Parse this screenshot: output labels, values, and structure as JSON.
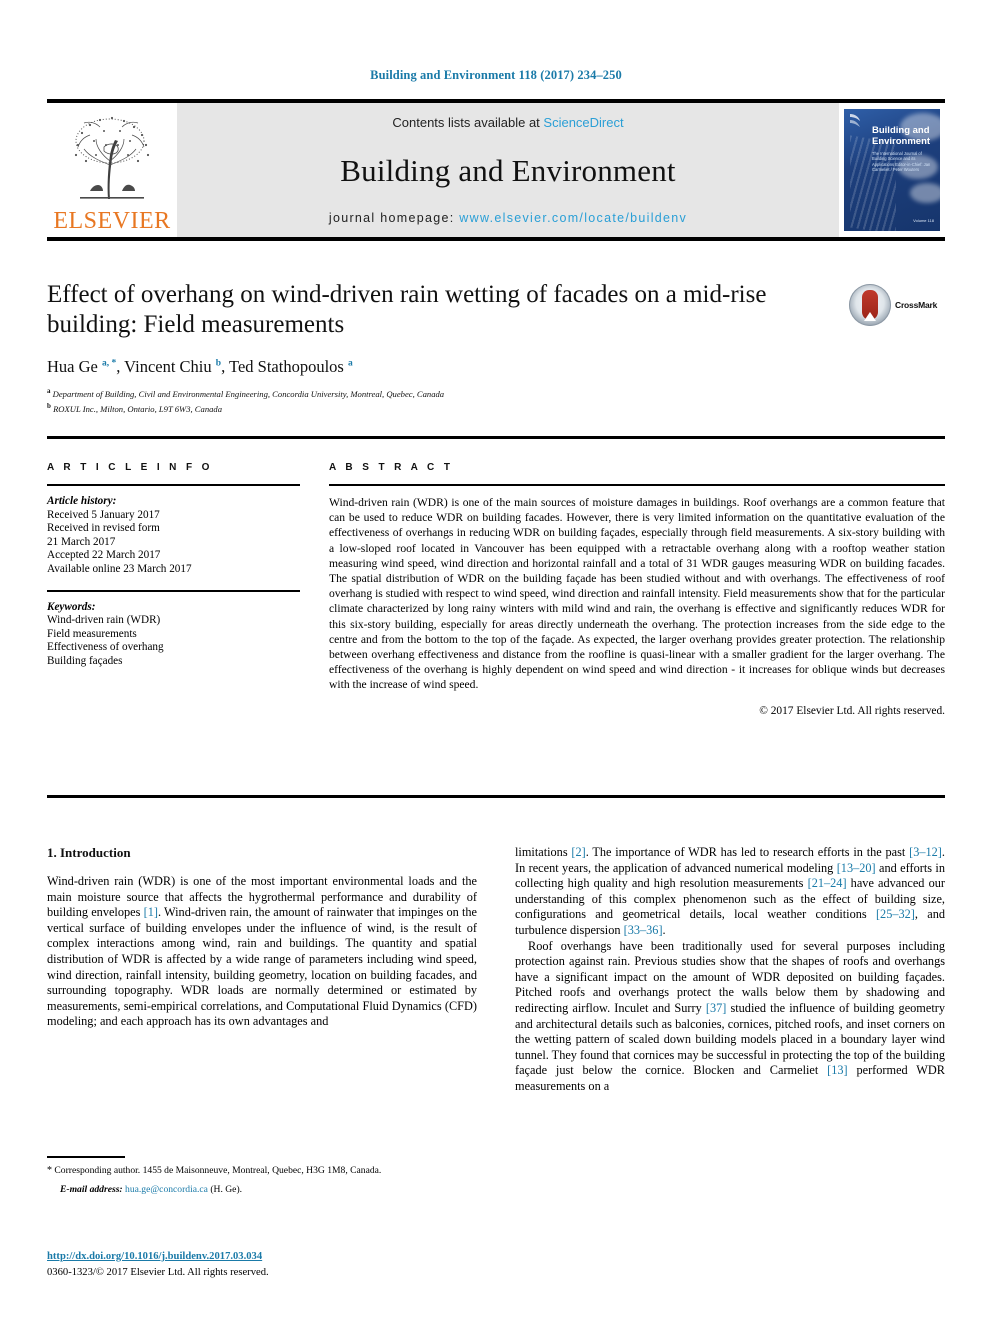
{
  "running_head": "Building and Environment 118 (2017) 234–250",
  "masthead": {
    "publisher_name": "ELSEVIER",
    "contents_prefix": "Contents lists available at ",
    "contents_link": "ScienceDirect",
    "journal_name": "Building and Environment",
    "homepage_prefix": "journal homepage: ",
    "homepage_url": "www.elsevier.com/locate/buildenv",
    "cover": {
      "title_line1": "Building and",
      "title_line2": "Environment",
      "subtitle": "The International Journal of Building Science and its Applications Editor-in-Chief: Jan Carmeliet / Peter Wouters",
      "bottom_note": "Volume 118"
    }
  },
  "crossmark": {
    "label": "CrossMark"
  },
  "article": {
    "title": "Effect of overhang on wind-driven rain wetting of facades on a mid-rise building: Field measurements",
    "authors_html": "Hua Ge <sup>a, *</sup>, Vincent Chiu <sup>b</sup>, Ted Stathopoulos <sup>a</sup>",
    "affiliations": [
      {
        "marker": "a",
        "text": "Department of Building, Civil and Environmental Engineering, Concordia University, Montreal, Quebec, Canada"
      },
      {
        "marker": "b",
        "text": "ROXUL Inc., Milton, Ontario, L9T 6W3, Canada"
      }
    ]
  },
  "article_info": {
    "heading": "A R T I C L E  I N F O",
    "history_label": "Article history:",
    "history": [
      "Received 5 January 2017",
      "Received in revised form",
      "21 March 2017",
      "Accepted 22 March 2017",
      "Available online 23 March 2017"
    ],
    "keywords_label": "Keywords:",
    "keywords": [
      "Wind-driven rain (WDR)",
      "Field measurements",
      "Effectiveness of overhang",
      "Building façades"
    ]
  },
  "abstract": {
    "heading": "A B S T R A C T",
    "text": "Wind-driven rain (WDR) is one of the main sources of moisture damages in buildings. Roof overhangs are a common feature that can be used to reduce WDR on building facades. However, there is very limited information on the quantitative evaluation of the effectiveness of overhangs in reducing WDR on building façades, especially through field measurements. A six-story building with a low-sloped roof located in Vancouver has been equipped with a retractable overhang along with a rooftop weather station measuring wind speed, wind direction and horizontal rainfall and a total of 31 WDR gauges measuring WDR on building facades. The spatial distribution of WDR on the building façade has been studied without and with overhangs. The effectiveness of roof overhang is studied with respect to wind speed, wind direction and rainfall intensity. Field measurements show that for the particular climate characterized by long rainy winters with mild wind and rain, the overhang is effective and significantly reduces WDR for this six-story building, especially for areas directly underneath the overhang. The protection increases from the side edge to the centre and from the bottom to the top of the façade. As expected, the larger overhang provides greater protection. The relationship between overhang effectiveness and distance from the roofline is quasi-linear with a smaller gradient for the larger overhang. The effectiveness of the overhang is highly dependent on wind speed and wind direction - it increases for oblique winds but decreases with the increase of wind speed.",
    "copyright": "© 2017 Elsevier Ltd. All rights reserved."
  },
  "body": {
    "section_title": "1. Introduction",
    "left_para_1_html": "Wind-driven rain (WDR) is one of the most important environmental loads and the main moisture source that affects the hygrothermal performance and durability of building envelopes <span class=\"ref\">[1]</span>. Wind-driven rain, the amount of rainwater that impinges on the vertical surface of building envelopes under the influence of wind, is the result of complex interactions among wind, rain and buildings. The quantity and spatial distribution of WDR is affected by a wide range of parameters including wind speed, wind direction, rainfall intensity, building geometry, location on building facades, and surrounding topography. WDR loads are normally determined or estimated by measurements, semi-empirical correlations, and Computational Fluid Dynamics (CFD) modeling; and each approach has its own advantages and",
    "right_para_1_html": "limitations <span class=\"ref\">[2]</span>. The importance of WDR has led to research efforts in the past <span class=\"ref\">[3–12]</span>. In recent years, the application of advanced numerical modeling <span class=\"ref\">[13–20]</span> and efforts in collecting high quality and high resolution measurements <span class=\"ref\">[21–24]</span> have advanced our understanding of this complex phenomenon such as the effect of building size, configurations and geometrical details, local weather conditions <span class=\"ref\">[25–32]</span>, and turbulence dispersion <span class=\"ref\">[33–36]</span>.",
    "right_para_2_html": "Roof overhangs have been traditionally used for several purposes including protection against rain. Previous studies show that the shapes of roofs and overhangs have a significant impact on the amount of WDR deposited on building façades. Pitched roofs and overhangs protect the walls below them by shadowing and redirecting airflow. Inculet and Surry <span class=\"ref\">[37]</span> studied the influence of building geometry and architectural details such as balconies, cornices, pitched roofs, and inset corners on the wetting pattern of scaled down building models placed in a boundary layer wind tunnel. They found that cornices may be successful in protecting the top of the building façade just below the cornice. Blocken and Carmeliet <span class=\"ref\">[13]</span> performed WDR measurements on a"
  },
  "footnote": {
    "corresponding_html": "<span class=\"star\">*</span> Corresponding author. 1455 de Maisonneuve, Montreal, Quebec, H3G 1M8, Canada.",
    "email_label": "E-mail address:",
    "email": "hua.ge@concordia.ca",
    "email_suffix": " (H. Ge)."
  },
  "doi": {
    "link": "http://dx.doi.org/10.1016/j.buildenv.2017.03.034",
    "copyright": "0360-1323/© 2017 Elsevier Ltd. All rights reserved."
  },
  "colors": {
    "link": "#1a7aa8",
    "sciencedirect": "#2a9fd6",
    "elsevier_orange": "#E87722",
    "masthead_bg": "#e6e6e6"
  }
}
